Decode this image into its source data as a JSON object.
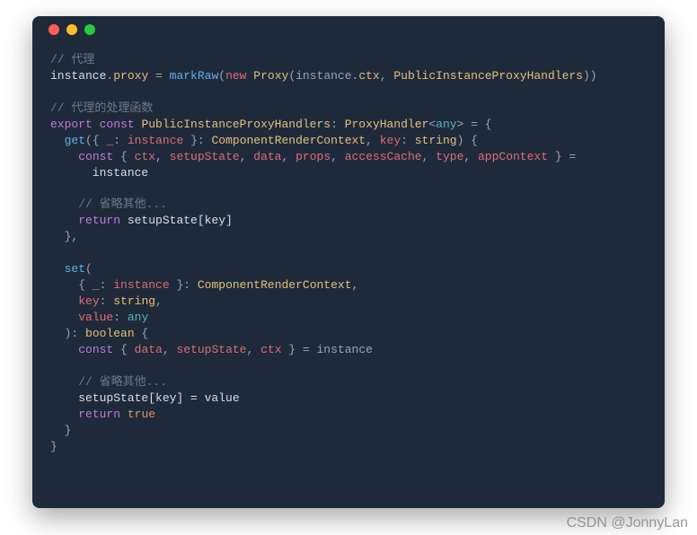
{
  "watermark": "CSDN @JonnyLan",
  "code": {
    "l01": "// 代理",
    "l02a": "instance",
    "l02b": ".",
    "l02c": "proxy",
    "l02d": " = ",
    "l02e": "markRaw",
    "l02f": "(",
    "l02g": "new",
    "l02h": " ",
    "l02i": "Proxy",
    "l02j": "(instance.",
    "l02k": "ctx",
    "l02l": ", ",
    "l02m": "PublicInstanceProxyHandlers",
    "l02n": "))",
    "l04": "// 代理的处理函数",
    "l05a": "export",
    "l05b": " ",
    "l05c": "const",
    "l05d": " ",
    "l05e": "PublicInstanceProxyHandlers",
    "l05f": ": ",
    "l05g": "ProxyHandler",
    "l05h": "<",
    "l05i": "any",
    "l05j": ">",
    "l05k": " = {",
    "l06a": "  ",
    "l06b": "get",
    "l06c": "({ ",
    "l06d": "_",
    "l06e": ": ",
    "l06f": "instance",
    "l06g": " }: ",
    "l06h": "ComponentRenderContext",
    "l06i": ", ",
    "l06j": "key",
    "l06k": ": ",
    "l06l": "string",
    "l06m": ") {",
    "l07a": "    ",
    "l07b": "const",
    "l07c": " { ",
    "l07d": "ctx",
    "l07e": ", ",
    "l07f": "setupState",
    "l07g": ", ",
    "l07h": "data",
    "l07i": ", ",
    "l07j": "props",
    "l07k": ", ",
    "l07l": "accessCache",
    "l07m": ", ",
    "l07n": "type",
    "l07o": ", ",
    "l07p": "appContext",
    "l07q": " } =",
    "l08": "      instance",
    "l10": "    // 省略其他...",
    "l11a": "    ",
    "l11b": "return",
    "l11c": " setupState[key]",
    "l12": "  },",
    "l14a": "  ",
    "l14b": "set",
    "l14c": "(",
    "l15a": "    { ",
    "l15b": "_",
    "l15c": ": ",
    "l15d": "instance",
    "l15e": " }: ",
    "l15f": "ComponentRenderContext",
    "l15g": ",",
    "l16a": "    ",
    "l16b": "key",
    "l16c": ": ",
    "l16d": "string",
    "l16e": ",",
    "l17a": "    ",
    "l17b": "value",
    "l17c": ": ",
    "l17d": "any",
    "l18a": "  ): ",
    "l18b": "boolean",
    "l18c": " {",
    "l19a": "    ",
    "l19b": "const",
    "l19c": " { ",
    "l19d": "data",
    "l19e": ", ",
    "l19f": "setupState",
    "l19g": ", ",
    "l19h": "ctx",
    "l19i": " } = instance",
    "l21": "    // 省略其他...",
    "l22": "    setupState[key] = value",
    "l23a": "    ",
    "l23b": "return",
    "l23c": " ",
    "l23d": "true",
    "l24": "  }",
    "l25": "}"
  }
}
